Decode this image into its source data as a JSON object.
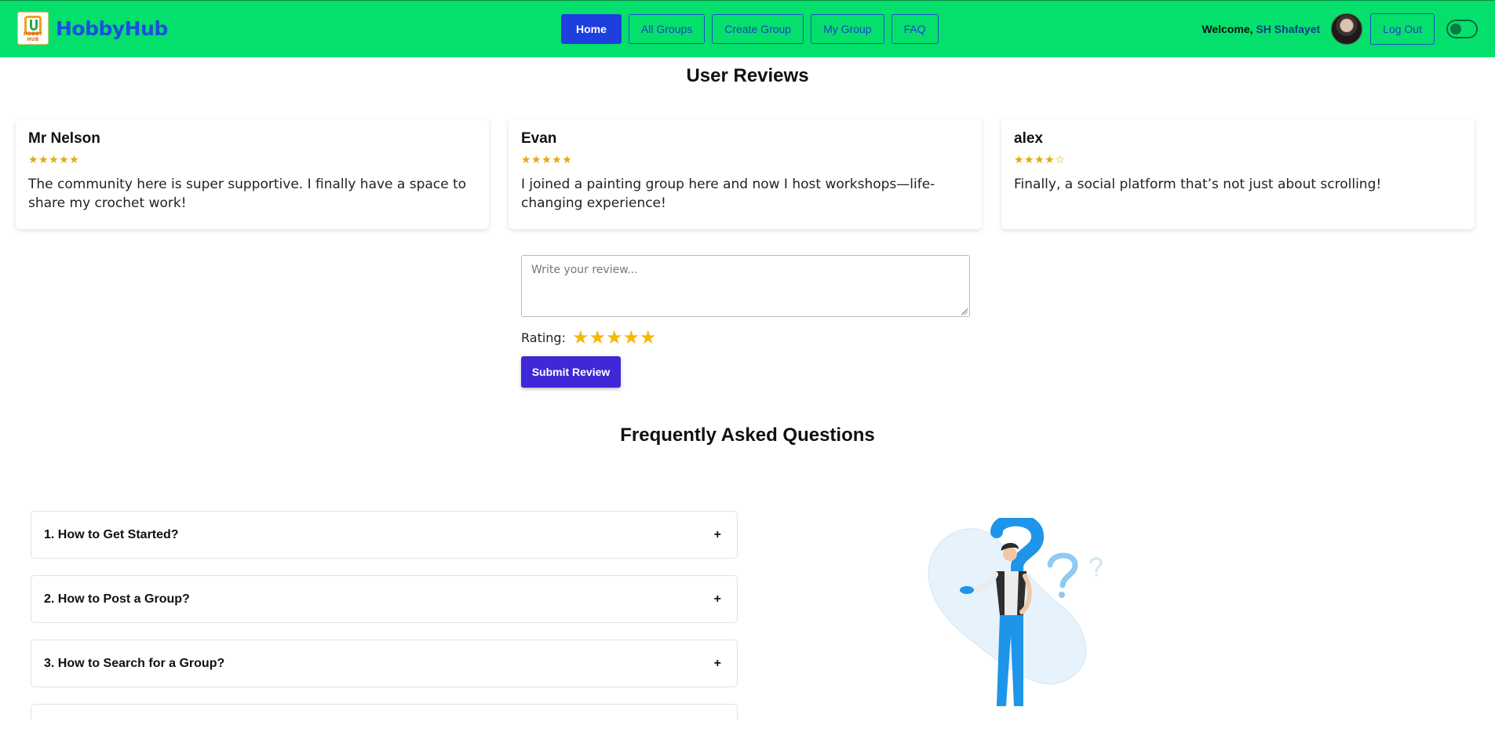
{
  "navbar": {
    "brand": "HobbyHub",
    "logo_caption": "HOBBY HUB",
    "links": [
      {
        "label": "Home",
        "active": true
      },
      {
        "label": "All Groups",
        "active": false
      },
      {
        "label": "Create Group",
        "active": false
      },
      {
        "label": "My Group",
        "active": false
      },
      {
        "label": "FAQ",
        "active": false
      }
    ],
    "welcome_prefix": "Welcome,",
    "user_name": "SH Shafayet",
    "logout_label": "Log Out",
    "theme_toggle": "off"
  },
  "reviews": {
    "title": "User Reviews",
    "items": [
      {
        "name": "Mr Nelson",
        "stars": "★★★★★",
        "rating": 5,
        "text": "The community here is super supportive. I finally have a space to share my crochet work!"
      },
      {
        "name": "Evan",
        "stars": "★★★★★",
        "rating": 5,
        "text": "I joined a painting group here and now I host workshops—life-changing experience!"
      },
      {
        "name": "alex",
        "stars": "★★★★☆",
        "rating": 4,
        "text": "Finally, a social platform that’s not just about scrolling!"
      }
    ],
    "form": {
      "placeholder": "Write your review...",
      "rating_label": "Rating:",
      "rating_value": 5,
      "submit_label": "Submit Review"
    }
  },
  "faq": {
    "title": "Frequently Asked Questions",
    "items": [
      {
        "question": "1. How to Get Started?",
        "toggle": "+"
      },
      {
        "question": "2. How to Post a Group?",
        "toggle": "+"
      },
      {
        "question": "3. How to Search for a Group?",
        "toggle": "+"
      }
    ]
  },
  "colors": {
    "navbar_bg": "#05e06d",
    "brand": "#1c4fe0",
    "primary_button": "#3f28d6",
    "star": "#e3a90e"
  }
}
